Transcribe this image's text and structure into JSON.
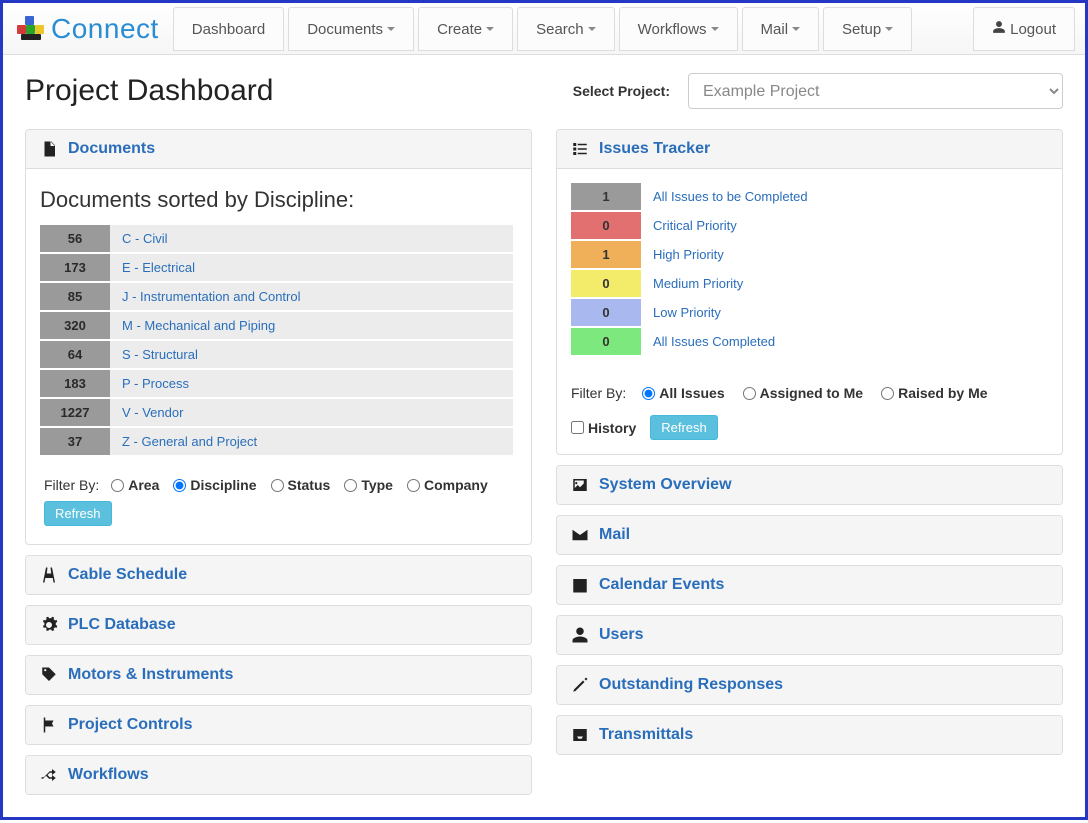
{
  "brand": {
    "text": "Connect"
  },
  "nav": {
    "dashboard": "Dashboard",
    "documents": "Documents",
    "create": "Create",
    "search": "Search",
    "workflows": "Workflows",
    "mail": "Mail",
    "setup": "Setup",
    "logout": "Logout"
  },
  "header": {
    "title": "Project Dashboard",
    "select_label": "Select Project:",
    "selected_project": "Example Project"
  },
  "documents_panel": {
    "title": "Documents",
    "subtitle": "Documents sorted by Discipline:",
    "rows": [
      {
        "count": "56",
        "label": "C - Civil"
      },
      {
        "count": "173",
        "label": "E - Electrical"
      },
      {
        "count": "85",
        "label": "J - Instrumentation and Control"
      },
      {
        "count": "320",
        "label": "M - Mechanical and Piping"
      },
      {
        "count": "64",
        "label": "S - Structural"
      },
      {
        "count": "183",
        "label": "P - Process"
      },
      {
        "count": "1227",
        "label": "V - Vendor"
      },
      {
        "count": "37",
        "label": "Z - General and Project"
      }
    ],
    "filter_by": "Filter By:",
    "filters": {
      "area": "Area",
      "discipline": "Discipline",
      "status": "Status",
      "type": "Type",
      "company": "Company"
    },
    "refresh": "Refresh"
  },
  "issues_panel": {
    "title": "Issues Tracker",
    "rows": [
      {
        "count": "1",
        "label": "All Issues to be Completed",
        "color": "#9a9a9a"
      },
      {
        "count": "0",
        "label": "Critical Priority",
        "color": "#e27070"
      },
      {
        "count": "1",
        "label": "High Priority",
        "color": "#f0b05a"
      },
      {
        "count": "0",
        "label": "Medium Priority",
        "color": "#f3ec6a"
      },
      {
        "count": "0",
        "label": "Low Priority",
        "color": "#aab8f0"
      },
      {
        "count": "0",
        "label": "All Issues Completed",
        "color": "#7de87d"
      }
    ],
    "filter_by": "Filter By:",
    "filters": {
      "all": "All Issues",
      "assigned": "Assigned to Me",
      "raised": "Raised by Me"
    },
    "history": "History",
    "refresh": "Refresh"
  },
  "left_panels": {
    "cable": "Cable Schedule",
    "plc": "PLC Database",
    "motors": "Motors & Instruments",
    "controls": "Project Controls",
    "workflows": "Workflows"
  },
  "right_panels": {
    "system": "System Overview",
    "mail": "Mail",
    "calendar": "Calendar Events",
    "users": "Users",
    "responses": "Outstanding Responses",
    "transmittals": "Transmittals"
  }
}
